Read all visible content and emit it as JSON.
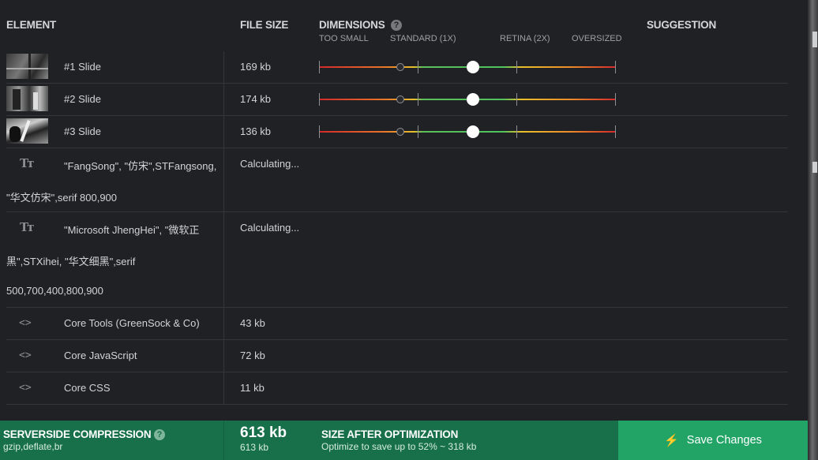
{
  "headers": {
    "element": "ELEMENT",
    "file_size": "FILE SIZE",
    "dimensions": "DIMENSIONS",
    "suggestion": "SUGGESTION"
  },
  "scale_labels": {
    "too_small": "TOO SMALL",
    "standard": "STANDARD (1X)",
    "retina": "RETINA (2X)",
    "oversized": "OVERSIZED"
  },
  "slides": [
    {
      "name": "#1 Slide",
      "size": "169 kb"
    },
    {
      "name": "#2 Slide",
      "size": "174 kb"
    },
    {
      "name": "#3 Slide",
      "size": "136 kb"
    }
  ],
  "fonts": [
    {
      "lines": [
        "\"FangSong\", \"仿宋\",STFangsong,",
        "\"华文仿宋\",serif 800,900"
      ],
      "size": "Calculating..."
    },
    {
      "lines": [
        "\"Microsoft JhengHei\", \"微软正",
        "黑\",STXihei, \"华文细黑\",serif",
        "500,700,400,800,900"
      ],
      "size": "Calculating..."
    }
  ],
  "scripts": [
    {
      "name": "Core Tools (GreenSock & Co)",
      "size": "43 kb"
    },
    {
      "name": "Core JavaScript",
      "size": "72 kb"
    },
    {
      "name": "Core CSS",
      "size": "11 kb"
    }
  ],
  "footer": {
    "compression_title": "SERVERSIDE COMPRESSION",
    "compression_value": "gzip,deflate,br",
    "total_big": "613 kb",
    "total_small": "613 kb",
    "optimization_title": "SIZE AFTER OPTIMIZATION",
    "optimization_text": "Optimize to save up to 52% ~ 318 kb",
    "save_label": "Save Changes"
  },
  "icons": {
    "help": "?",
    "font": "Tт",
    "code": "<>",
    "bolt": "⚡"
  },
  "colors": {
    "footer_bg": "#17704a",
    "save_button": "#21a466",
    "panel_bg": "#202125"
  }
}
